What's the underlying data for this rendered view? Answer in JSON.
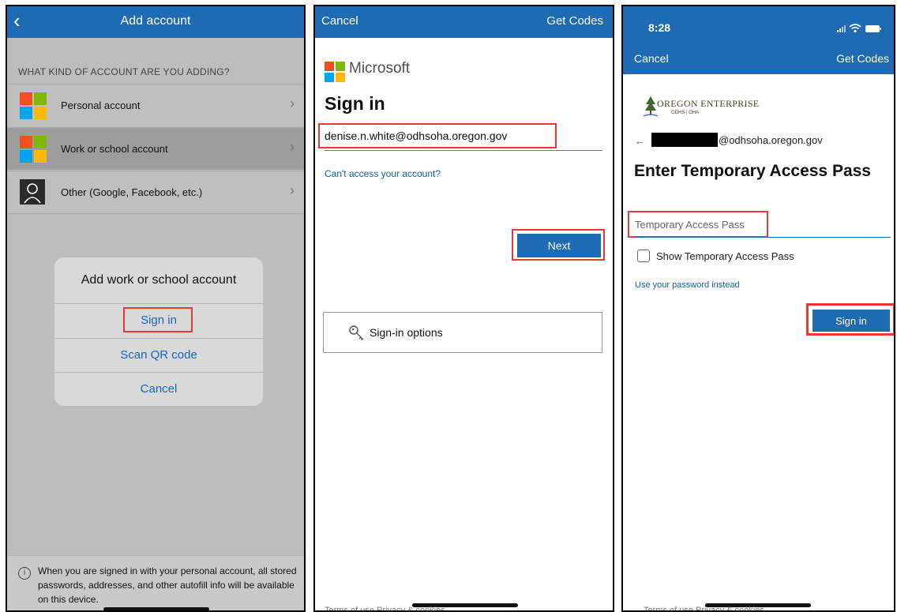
{
  "panel1": {
    "back_glyph": "‹",
    "title": "Add account",
    "section_label": "WHAT KIND OF ACCOUNT ARE YOU ADDING?",
    "rows": [
      {
        "label": "Personal account",
        "chevron": "›"
      },
      {
        "label": "Work or school account",
        "chevron": "›"
      },
      {
        "label": "Other (Google, Facebook, etc.)",
        "chevron": "›"
      }
    ],
    "dialog": {
      "title": "Add work or school account",
      "sign_in": "Sign in",
      "scan_qr": "Scan QR code",
      "cancel": "Cancel"
    },
    "footer_icon": "i",
    "footer_text": "When you are signed in with your personal account, all stored passwords, addresses, and other autofill info will be available on this device."
  },
  "panel2": {
    "cancel": "Cancel",
    "get_codes": "Get Codes",
    "brand": "Microsoft",
    "heading": "Sign in",
    "email": "denise.n.white@odhsoha.oregon.gov",
    "cant_access": "Can't access your account?",
    "next": "Next",
    "signin_options": "Sign-in options",
    "footer": "Terms of use    Privacy & cookies"
  },
  "panel3": {
    "time": "8:28",
    "cancel": "Cancel",
    "get_codes": "Get Codes",
    "logo_text": "OREGON ENTERPRISE",
    "logo_sub": "ODHS | OHA",
    "back_arrow": "←",
    "domain": "@odhsoha.oregon.gov",
    "heading": "Enter Temporary Access Pass",
    "tap_placeholder": "Temporary Access Pass",
    "show_tap": "Show Temporary Access Pass",
    "use_password": "Use your password instead",
    "sign_in": "Sign in",
    "footer": "Terms of use    Privacy & cookies"
  },
  "colors": {
    "accent_blue": "#1e6ab3",
    "highlight_red": "#e53935",
    "link_blue": "#0c62a8"
  }
}
